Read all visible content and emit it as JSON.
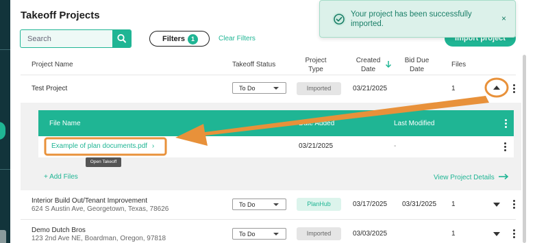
{
  "page": {
    "title": "Takeoff Projects",
    "search_placeholder": "Search",
    "filters_label": "Filters",
    "filters_count": "1",
    "clear_filters": "Clear Filters",
    "import_button": "Import project"
  },
  "toast": {
    "message": "Your project has been successfully imported.",
    "close": "×"
  },
  "table": {
    "headers": {
      "name": "Project Name",
      "status": "Takeoff Status",
      "type": "Project Type",
      "created": "Created Date",
      "due": "Bid Due Date",
      "files": "Files"
    },
    "rows": [
      {
        "name": "Test Project",
        "address": "",
        "status": "To Do",
        "type": "Imported",
        "created": "03/21/2025",
        "due": "",
        "files": "1"
      },
      {
        "name": "Interior Build Out/Tenant Improvement",
        "address": "624 S Austin Ave, Georgetown, Texas, 78626",
        "status": "To Do",
        "type": "PlanHub",
        "created": "03/17/2025",
        "due": "03/31/2025",
        "files": "1"
      },
      {
        "name": "Demo Dutch Bros",
        "address": "123 2nd Ave NE, Boardman, Oregon, 97818",
        "status": "To Do",
        "type": "Imported",
        "created": "03/03/2025",
        "due": "",
        "files": "1"
      }
    ]
  },
  "files_table": {
    "headers": {
      "file_name": "File Name",
      "date_added": "Date Added",
      "last_modified": "Last Modified"
    },
    "rows": [
      {
        "file_name": "Example of plan documents.pdf",
        "date_added": "03/21/2025",
        "last_modified": "-"
      }
    ],
    "tooltip": "Open Takeoff",
    "add_files": "+ Add Files",
    "view_details": "View Project Details"
  },
  "colors": {
    "accent": "#1fb594",
    "annotation": "#e8913a",
    "sidebar": "#12343b"
  }
}
